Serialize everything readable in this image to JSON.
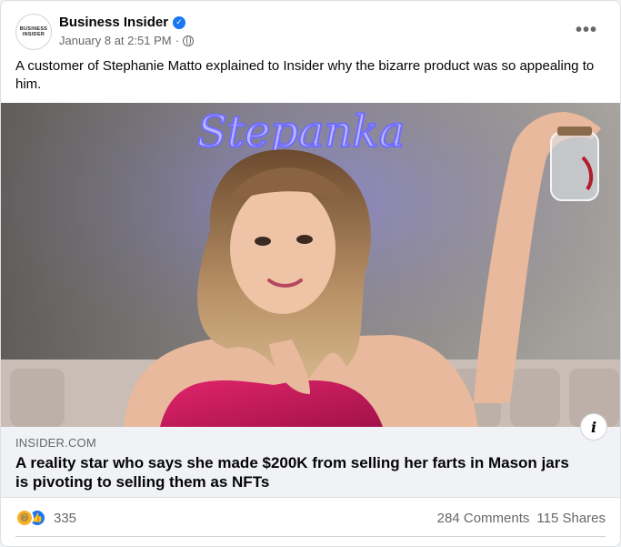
{
  "post": {
    "page_name": "Business Insider",
    "avatar_text": "BUSINESS\nINSIDER",
    "timestamp": "January 8 at 2:51 PM",
    "separator": "·",
    "more_label": "•••",
    "text": "A customer of Stephanie Matto explained to Insider why the bizarre product was so appealing to him.",
    "image": {
      "neon_sign": "Stepanka",
      "colors": {
        "wall": "#6e6b66",
        "neon": "#6f6cff",
        "dress": "#d11a5e",
        "sofa": "#c9bdb6"
      }
    }
  },
  "link": {
    "domain": "INSIDER.COM",
    "title": "A reality star who says she made $200K from selling her farts in Mason jars is pivoting to selling them as NFTs",
    "info_label": "i"
  },
  "engagement": {
    "reaction_count": "335",
    "comments": "284 Comments",
    "shares": "115 Shares",
    "reaction_icons": [
      "haha-icon",
      "like-icon"
    ]
  },
  "colors": {
    "accent": "#1877f2",
    "secondary_text": "#65676b",
    "link_bg": "#f0f2f5"
  }
}
